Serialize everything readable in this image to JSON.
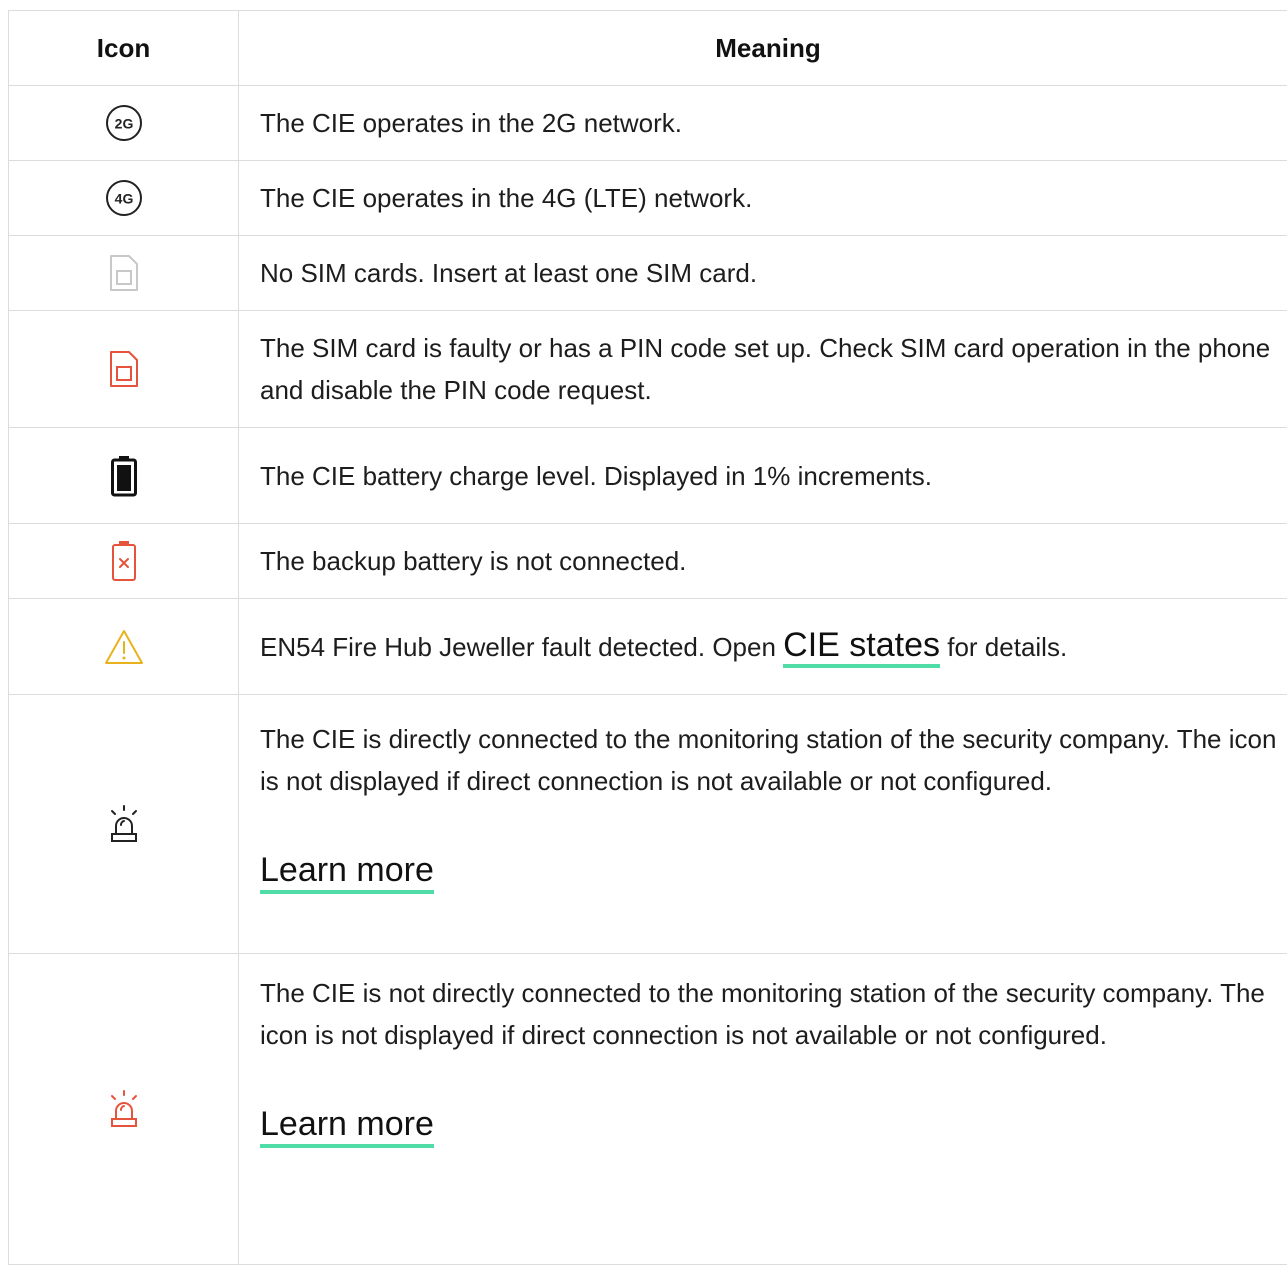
{
  "header": {
    "icon_col": "Icon",
    "meaning_col": "Meaning"
  },
  "rows": [
    {
      "icon": "2g-icon",
      "text": "The CIE operates in the 2G network."
    },
    {
      "icon": "4g-icon",
      "text": "The CIE operates in the 4G (LTE) network."
    },
    {
      "icon": "no-sim-icon",
      "text": "No SIM cards. Insert at least one SIM card."
    },
    {
      "icon": "sim-fault-icon",
      "text": "The SIM card is faulty or has a PIN code set up. Check SIM card operation in the phone and disable the PIN code request."
    },
    {
      "icon": "battery-icon",
      "text": "The CIE battery charge level. Displayed in 1% increments."
    },
    {
      "icon": "battery-not-connected-icon",
      "text": "The backup battery is not connected."
    },
    {
      "icon": "warning-icon",
      "text_before": "EN54 Fire Hub Jeweller fault detected. Open ",
      "link": "CIE states",
      "text_after": " for details."
    },
    {
      "icon": "siren-icon",
      "text": "The CIE is directly connected to the monitoring station of the security company. The icon is not displayed if direct connection is not available or not configured.",
      "link": "Learn more"
    },
    {
      "icon": "siren-red-icon",
      "text": "The CIE is not directly connected to the monitoring station of the security company. The icon is not displayed if direct connection is not available or not configured.",
      "link": "Learn more"
    }
  ],
  "colors": {
    "accent_underline": "#4fdca6",
    "fault_red": "#e5533d",
    "warning_yellow": "#e8b21c",
    "inactive_gray": "#c8c8c8"
  },
  "badges": {
    "two_g": "2G",
    "four_g": "4G"
  }
}
